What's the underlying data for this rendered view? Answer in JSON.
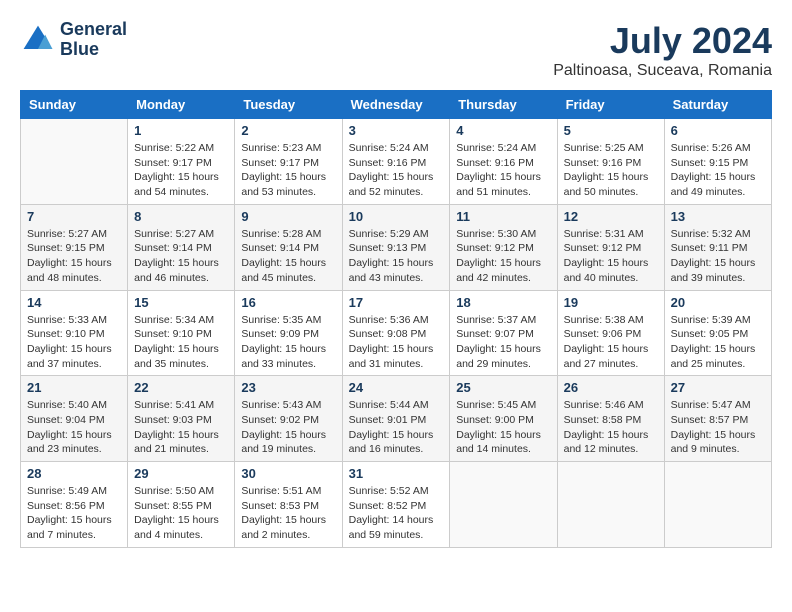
{
  "header": {
    "logo_line1": "General",
    "logo_line2": "Blue",
    "month": "July 2024",
    "location": "Paltinoasa, Suceava, Romania"
  },
  "columns": [
    "Sunday",
    "Monday",
    "Tuesday",
    "Wednesday",
    "Thursday",
    "Friday",
    "Saturday"
  ],
  "weeks": [
    [
      {
        "day": "",
        "info": ""
      },
      {
        "day": "1",
        "info": "Sunrise: 5:22 AM\nSunset: 9:17 PM\nDaylight: 15 hours\nand 54 minutes."
      },
      {
        "day": "2",
        "info": "Sunrise: 5:23 AM\nSunset: 9:17 PM\nDaylight: 15 hours\nand 53 minutes."
      },
      {
        "day": "3",
        "info": "Sunrise: 5:24 AM\nSunset: 9:16 PM\nDaylight: 15 hours\nand 52 minutes."
      },
      {
        "day": "4",
        "info": "Sunrise: 5:24 AM\nSunset: 9:16 PM\nDaylight: 15 hours\nand 51 minutes."
      },
      {
        "day": "5",
        "info": "Sunrise: 5:25 AM\nSunset: 9:16 PM\nDaylight: 15 hours\nand 50 minutes."
      },
      {
        "day": "6",
        "info": "Sunrise: 5:26 AM\nSunset: 9:15 PM\nDaylight: 15 hours\nand 49 minutes."
      }
    ],
    [
      {
        "day": "7",
        "info": "Sunrise: 5:27 AM\nSunset: 9:15 PM\nDaylight: 15 hours\nand 48 minutes."
      },
      {
        "day": "8",
        "info": "Sunrise: 5:27 AM\nSunset: 9:14 PM\nDaylight: 15 hours\nand 46 minutes."
      },
      {
        "day": "9",
        "info": "Sunrise: 5:28 AM\nSunset: 9:14 PM\nDaylight: 15 hours\nand 45 minutes."
      },
      {
        "day": "10",
        "info": "Sunrise: 5:29 AM\nSunset: 9:13 PM\nDaylight: 15 hours\nand 43 minutes."
      },
      {
        "day": "11",
        "info": "Sunrise: 5:30 AM\nSunset: 9:12 PM\nDaylight: 15 hours\nand 42 minutes."
      },
      {
        "day": "12",
        "info": "Sunrise: 5:31 AM\nSunset: 9:12 PM\nDaylight: 15 hours\nand 40 minutes."
      },
      {
        "day": "13",
        "info": "Sunrise: 5:32 AM\nSunset: 9:11 PM\nDaylight: 15 hours\nand 39 minutes."
      }
    ],
    [
      {
        "day": "14",
        "info": "Sunrise: 5:33 AM\nSunset: 9:10 PM\nDaylight: 15 hours\nand 37 minutes."
      },
      {
        "day": "15",
        "info": "Sunrise: 5:34 AM\nSunset: 9:10 PM\nDaylight: 15 hours\nand 35 minutes."
      },
      {
        "day": "16",
        "info": "Sunrise: 5:35 AM\nSunset: 9:09 PM\nDaylight: 15 hours\nand 33 minutes."
      },
      {
        "day": "17",
        "info": "Sunrise: 5:36 AM\nSunset: 9:08 PM\nDaylight: 15 hours\nand 31 minutes."
      },
      {
        "day": "18",
        "info": "Sunrise: 5:37 AM\nSunset: 9:07 PM\nDaylight: 15 hours\nand 29 minutes."
      },
      {
        "day": "19",
        "info": "Sunrise: 5:38 AM\nSunset: 9:06 PM\nDaylight: 15 hours\nand 27 minutes."
      },
      {
        "day": "20",
        "info": "Sunrise: 5:39 AM\nSunset: 9:05 PM\nDaylight: 15 hours\nand 25 minutes."
      }
    ],
    [
      {
        "day": "21",
        "info": "Sunrise: 5:40 AM\nSunset: 9:04 PM\nDaylight: 15 hours\nand 23 minutes."
      },
      {
        "day": "22",
        "info": "Sunrise: 5:41 AM\nSunset: 9:03 PM\nDaylight: 15 hours\nand 21 minutes."
      },
      {
        "day": "23",
        "info": "Sunrise: 5:43 AM\nSunset: 9:02 PM\nDaylight: 15 hours\nand 19 minutes."
      },
      {
        "day": "24",
        "info": "Sunrise: 5:44 AM\nSunset: 9:01 PM\nDaylight: 15 hours\nand 16 minutes."
      },
      {
        "day": "25",
        "info": "Sunrise: 5:45 AM\nSunset: 9:00 PM\nDaylight: 15 hours\nand 14 minutes."
      },
      {
        "day": "26",
        "info": "Sunrise: 5:46 AM\nSunset: 8:58 PM\nDaylight: 15 hours\nand 12 minutes."
      },
      {
        "day": "27",
        "info": "Sunrise: 5:47 AM\nSunset: 8:57 PM\nDaylight: 15 hours\nand 9 minutes."
      }
    ],
    [
      {
        "day": "28",
        "info": "Sunrise: 5:49 AM\nSunset: 8:56 PM\nDaylight: 15 hours\nand 7 minutes."
      },
      {
        "day": "29",
        "info": "Sunrise: 5:50 AM\nSunset: 8:55 PM\nDaylight: 15 hours\nand 4 minutes."
      },
      {
        "day": "30",
        "info": "Sunrise: 5:51 AM\nSunset: 8:53 PM\nDaylight: 15 hours\nand 2 minutes."
      },
      {
        "day": "31",
        "info": "Sunrise: 5:52 AM\nSunset: 8:52 PM\nDaylight: 14 hours\nand 59 minutes."
      },
      {
        "day": "",
        "info": ""
      },
      {
        "day": "",
        "info": ""
      },
      {
        "day": "",
        "info": ""
      }
    ]
  ]
}
